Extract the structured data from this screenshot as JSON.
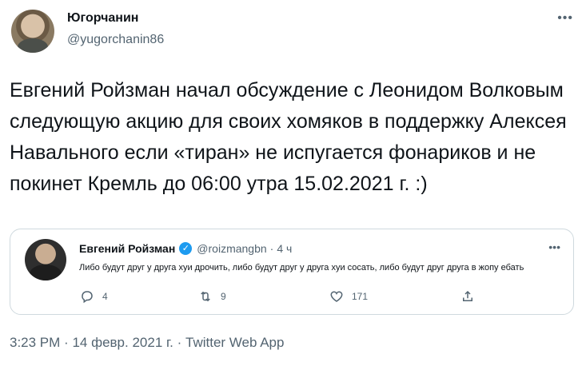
{
  "author": {
    "name": "Югорчанин",
    "handle": "@yugorchanin86"
  },
  "tweet": {
    "text": "Евгений Ройзман начал обсуждение с Леонидом Волковым следующую акцию для своих хомяков в поддержку Алексея Навального если «тиран» не испугается фонариков и не покинет Кремль до 06:00 утра 15.02.2021 г. :)"
  },
  "quote": {
    "name": "Евгений Ройзман",
    "handle": "@roizmangbn",
    "separator": "·",
    "time": "4 ч",
    "text": "Либо будут друг у друга хуи дрочить, либо будут друг у друга хуи сосать, либо будут друг друга в жопу ебать",
    "actions": {
      "reply_count": "4",
      "retweet_count": "9",
      "like_count": "171"
    }
  },
  "meta": {
    "time": "3:23 PM",
    "separator1": "·",
    "date": "14 февр. 2021 г.",
    "separator2": "·",
    "source": "Twitter Web App"
  },
  "icons": {
    "more": "more-horizontal-icon",
    "verified": "verified-badge-icon",
    "reply": "reply-icon",
    "retweet": "retweet-icon",
    "like": "heart-icon",
    "share": "share-icon"
  },
  "colors": {
    "text": "#0f1419",
    "secondary": "#536471",
    "border": "#cfd9de",
    "verified": "#1d9bf0"
  }
}
